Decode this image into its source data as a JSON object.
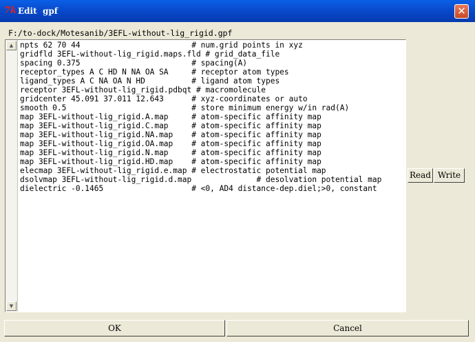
{
  "window": {
    "title": "Edit  gpf",
    "icon": "tk-icon",
    "close_label": "✕"
  },
  "file_path": "F:/to-dock/Motesanib/3EFL-without-lig_rigid.gpf",
  "editor": {
    "content": "npts 62 70 44                        # num.grid points in xyz\ngridfld 3EFL-without-lig_rigid.maps.fld # grid_data_file\nspacing 0.375                        # spacing(A)\nreceptor_types A C HD N NA OA SA     # receptor atom types\nligand_types A C NA OA N HD          # ligand atom types\nreceptor 3EFL-without-lig_rigid.pdbqt # macromolecule\ngridcenter 45.091 37.011 12.643      # xyz-coordinates or auto\nsmooth 0.5                           # store minimum energy w/in rad(A)\nmap 3EFL-without-lig_rigid.A.map     # atom-specific affinity map\nmap 3EFL-without-lig_rigid.C.map     # atom-specific affinity map\nmap 3EFL-without-lig_rigid.NA.map    # atom-specific affinity map\nmap 3EFL-without-lig_rigid.OA.map    # atom-specific affinity map\nmap 3EFL-without-lig_rigid.N.map     # atom-specific affinity map\nmap 3EFL-without-lig_rigid.HD.map    # atom-specific affinity map\nelecmap 3EFL-without-lig_rigid.e.map # electrostatic potential map\ndsolvmap 3EFL-without-lig_rigid.d.map              # desolvation potential map\ndielectric -0.1465                   # <0, AD4 distance-dep.diel;>0, constant"
  },
  "buttons": {
    "read": "Read",
    "write": "Write",
    "ok": "OK",
    "cancel": "Cancel"
  },
  "scrollbar": {
    "up_glyph": "▲",
    "down_glyph": "▼"
  },
  "colors": {
    "titlebar": "#0847c7",
    "window_bg": "#ece9d8",
    "close_button": "#c84a24"
  }
}
